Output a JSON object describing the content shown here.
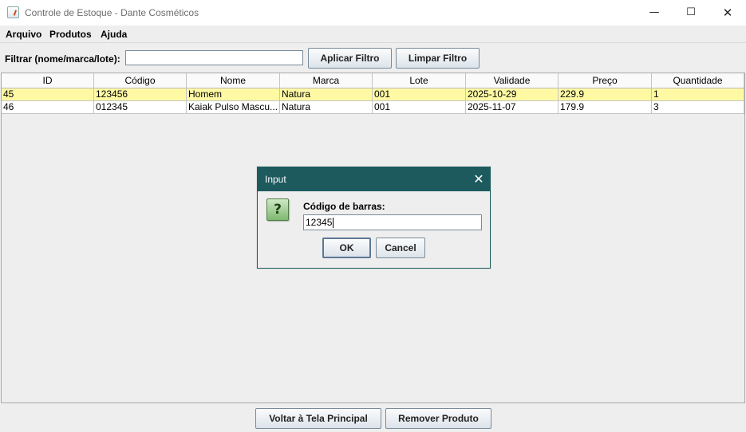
{
  "window": {
    "title": "Controle de Estoque - Dante Cosméticos",
    "minimize": "—",
    "maximize": "☐",
    "close": "✕"
  },
  "menu": [
    "Arquivo",
    "Produtos",
    "Ajuda"
  ],
  "filter": {
    "label": "Filtrar (nome/marca/lote):",
    "value": "",
    "apply_label": "Aplicar Filtro",
    "clear_label": "Limpar Filtro"
  },
  "table": {
    "columns": [
      "ID",
      "Código",
      "Nome",
      "Marca",
      "Lote",
      "Validade",
      "Preço",
      "Quantidade"
    ],
    "rows": [
      [
        "45",
        "123456",
        "Homem",
        "Natura",
        "001",
        "2025-10-29",
        "229.9",
        "1"
      ],
      [
        "46",
        "012345",
        "Kaiak Pulso Mascu...",
        "Natura",
        "001",
        "2025-11-07",
        "179.9",
        "3"
      ]
    ],
    "selected_row_color": "#fff9a4"
  },
  "dialog": {
    "title": "Input",
    "close": "✕",
    "icon": "question-icon",
    "icon_glyph": "?",
    "prompt": "Código de barras:",
    "value": "12345",
    "ok_label": "OK",
    "cancel_label": "Cancel",
    "title_color": "#1c5a5e"
  },
  "bottom": {
    "back_label": "Voltar à Tela Principal",
    "remove_label": "Remover Produto"
  }
}
